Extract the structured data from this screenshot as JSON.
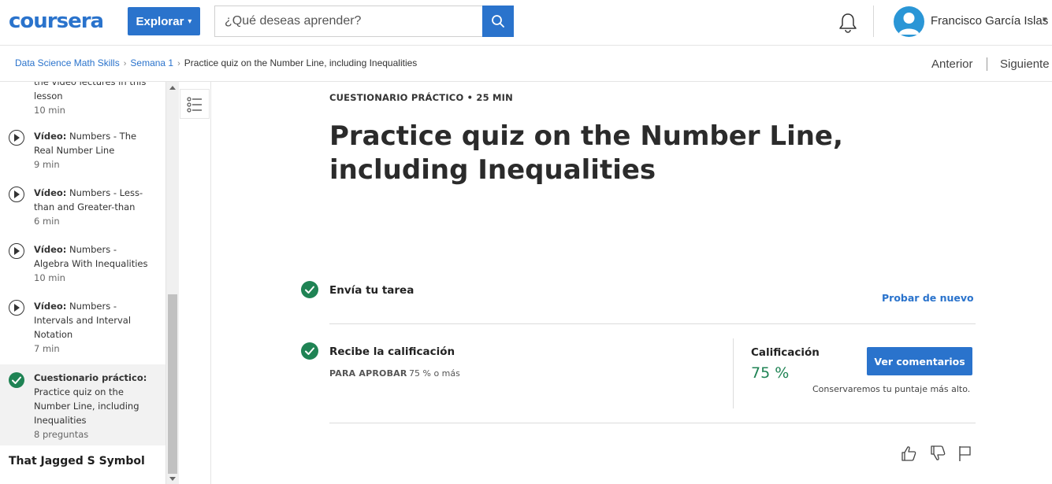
{
  "header": {
    "logo_text": "coursera",
    "explore_label": "Explorar",
    "search_placeholder": "¿Qué deseas aprender?",
    "user_name": "Francisco García Islas"
  },
  "breadcrumb": {
    "items": [
      "Data Science Math Skills",
      "Semana 1"
    ],
    "current": "Practice quiz on the Number Line, including Inequalities"
  },
  "nav": {
    "previous": "Anterior",
    "next": "Siguiente"
  },
  "sidebar": {
    "partial_item": {
      "text": "the video lectures in this lesson",
      "meta": "10 min"
    },
    "items": [
      {
        "kind": "Vídeo:",
        "title": "Numbers - The Real Number Line",
        "meta": "9 min"
      },
      {
        "kind": "Vídeo:",
        "title": "Numbers - Less-than and Greater-than",
        "meta": "6 min"
      },
      {
        "kind": "Vídeo:",
        "title": "Numbers - Algebra With Inequalities",
        "meta": "10 min"
      },
      {
        "kind": "Vídeo:",
        "title": "Numbers - Intervals and Interval Notation",
        "meta": "7 min"
      }
    ],
    "active_item": {
      "kind": "Cuestionario práctico:",
      "title": "Practice quiz on the Number Line, including Inequalities",
      "meta": "8 preguntas"
    },
    "section_title": "That Jagged S Symbol"
  },
  "main": {
    "kicker": "CUESTIONARIO PRÁCTICO • 25 MIN",
    "title": "Practice quiz on the Number Line, including Inequalities",
    "step1": {
      "title": "Envía tu tarea",
      "link": "Probar de nuevo"
    },
    "step2": {
      "title": "Recibe la calificación",
      "pass_label": "PARA APROBAR",
      "pass_value": "75 % o más",
      "grade_label": "Calificación",
      "grade_value": "75 %",
      "button": "Ver comentarios",
      "note": "Conservaremos tu puntaje más alto."
    }
  },
  "colors": {
    "brand": "#2a73cc",
    "success": "#1f8354"
  },
  "icons": [
    "search-icon",
    "bell-icon",
    "user-avatar-icon",
    "play-icon",
    "check-icon",
    "outline-list-icon",
    "thumbs-up-icon",
    "thumbs-down-icon",
    "flag-icon"
  ]
}
